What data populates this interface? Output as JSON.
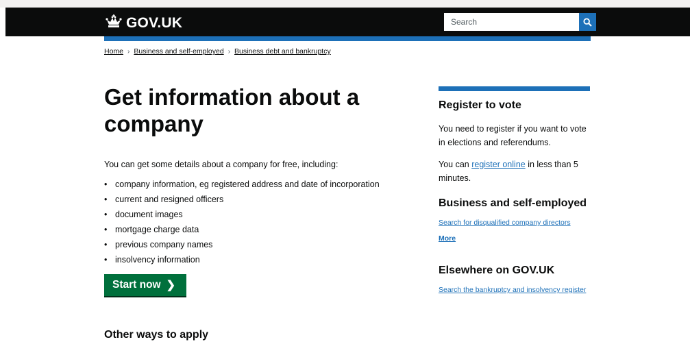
{
  "header": {
    "logo_text": "GOV.UK",
    "search_placeholder": "Search"
  },
  "breadcrumb": [
    "Home",
    "Business and self-employed",
    "Business debt and bankruptcy"
  ],
  "main": {
    "title_line1": "Get information about a",
    "title_line2": "company",
    "intro": "You can get some details about a company for free, including:",
    "bullets": [
      "company information, eg registered address and date of incorporation",
      "current and resigned officers",
      "document images",
      "mortgage charge data",
      "previous company names",
      "insolvency information"
    ],
    "start_button": "Start now",
    "other_ways": "Other ways to apply"
  },
  "sidebar": {
    "register_heading": "Register to vote",
    "register_text": "You need to register if you want to vote in elections and referendums.",
    "register_prefix": "You can ",
    "register_link": "register online",
    "register_suffix": " in less than 5 minutes.",
    "business_heading": "Business and self-employed",
    "business_link": "Search for disqualified company directors",
    "more_link": "More",
    "elsewhere_heading": "Elsewhere on GOV.UK",
    "elsewhere_link": "Search the bankruptcy and insolvency register"
  },
  "colors": {
    "header_bg": "#0b0c0c",
    "brand_blue": "#1d70b8",
    "start_green": "#00703c"
  },
  "icons": {
    "logo": "crown-icon",
    "search": "search-icon",
    "start": "chevron-right-icon"
  }
}
